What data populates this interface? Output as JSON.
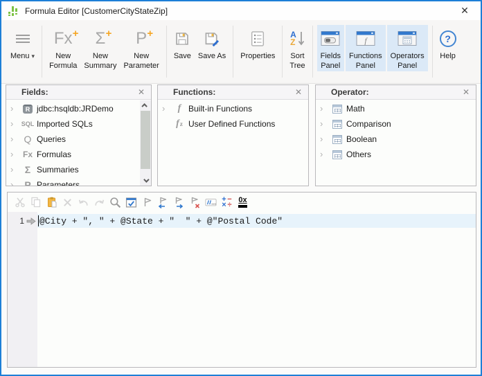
{
  "window": {
    "title": "Formula Editor [CustomerCityStateZip]"
  },
  "toolbar": {
    "menu": {
      "label": "Menu"
    },
    "new_formula": {
      "line1": "New",
      "line2": "Formula"
    },
    "new_summary": {
      "line1": "New",
      "line2": "Summary"
    },
    "new_parameter": {
      "line1": "New",
      "line2": "Parameter"
    },
    "save": {
      "label": "Save"
    },
    "save_as": {
      "label": "Save As"
    },
    "properties": {
      "label": "Properties"
    },
    "sort_tree": {
      "line1": "Sort",
      "line2": "Tree"
    },
    "fields_panel": {
      "line1": "Fields",
      "line2": "Panel"
    },
    "functions_panel": {
      "line1": "Functions",
      "line2": "Panel"
    },
    "operators_panel": {
      "line1": "Operators",
      "line2": "Panel"
    },
    "help": {
      "label": "Help"
    }
  },
  "panels": {
    "fields": {
      "title": "Fields:",
      "items": [
        {
          "icon": "datasource-icon",
          "label": "jdbc:hsqldb:JRDemo"
        },
        {
          "icon": "sql-icon",
          "label": "Imported SQLs"
        },
        {
          "icon": "query-icon",
          "label": "Queries"
        },
        {
          "icon": "formula-icon",
          "label": "Formulas"
        },
        {
          "icon": "summary-icon",
          "label": "Summaries"
        },
        {
          "icon": "parameter-icon",
          "label": "Parameters"
        }
      ]
    },
    "functions": {
      "title": "Functions:",
      "items": [
        {
          "icon": "builtin-function-icon",
          "label": "Built-in Functions"
        },
        {
          "icon": "user-function-icon",
          "label": "User Defined Functions"
        }
      ]
    },
    "operator": {
      "title": "Operator:",
      "items": [
        {
          "icon": "calculator-icon",
          "label": "Math"
        },
        {
          "icon": "calculator-icon",
          "label": "Comparison"
        },
        {
          "icon": "calculator-icon",
          "label": "Boolean"
        },
        {
          "icon": "calculator-icon",
          "label": "Others"
        }
      ]
    }
  },
  "editor": {
    "line_number": "1",
    "formula": "@City + \", \" + @State + \"  \" + @\"Postal Code\""
  },
  "icons": {
    "close": "✕",
    "panel_close": "✕",
    "dropdown_caret": "▾",
    "chevron": "›",
    "plus_badge": "+",
    "new_formula_glyph": "Fx",
    "new_summary_glyph": "Σ",
    "new_parameter_glyph": "P",
    "sort_a": "A",
    "sort_z": "Z",
    "help_glyph": "?",
    "datasource_glyph": "R",
    "sql_glyph": "SQL",
    "query_glyph": "Q",
    "formula_glyph": "Fx",
    "summary_glyph": "Σ",
    "parameter_glyph": "P",
    "function_glyph": "f",
    "user_function_sub": "z",
    "window_fn_glyph": "f",
    "math_plus": "+",
    "math_minus": "−",
    "math_times": "×",
    "math_divide": "÷",
    "hex_glyph": "0x"
  },
  "colors": {
    "accent_blue": "#1d7fd7",
    "icon_blue": "#2e6fd0",
    "orange": "#f5a623",
    "panel_toggle_bg": "#dbe9f7",
    "line_highlight": "#e7f3fb"
  }
}
